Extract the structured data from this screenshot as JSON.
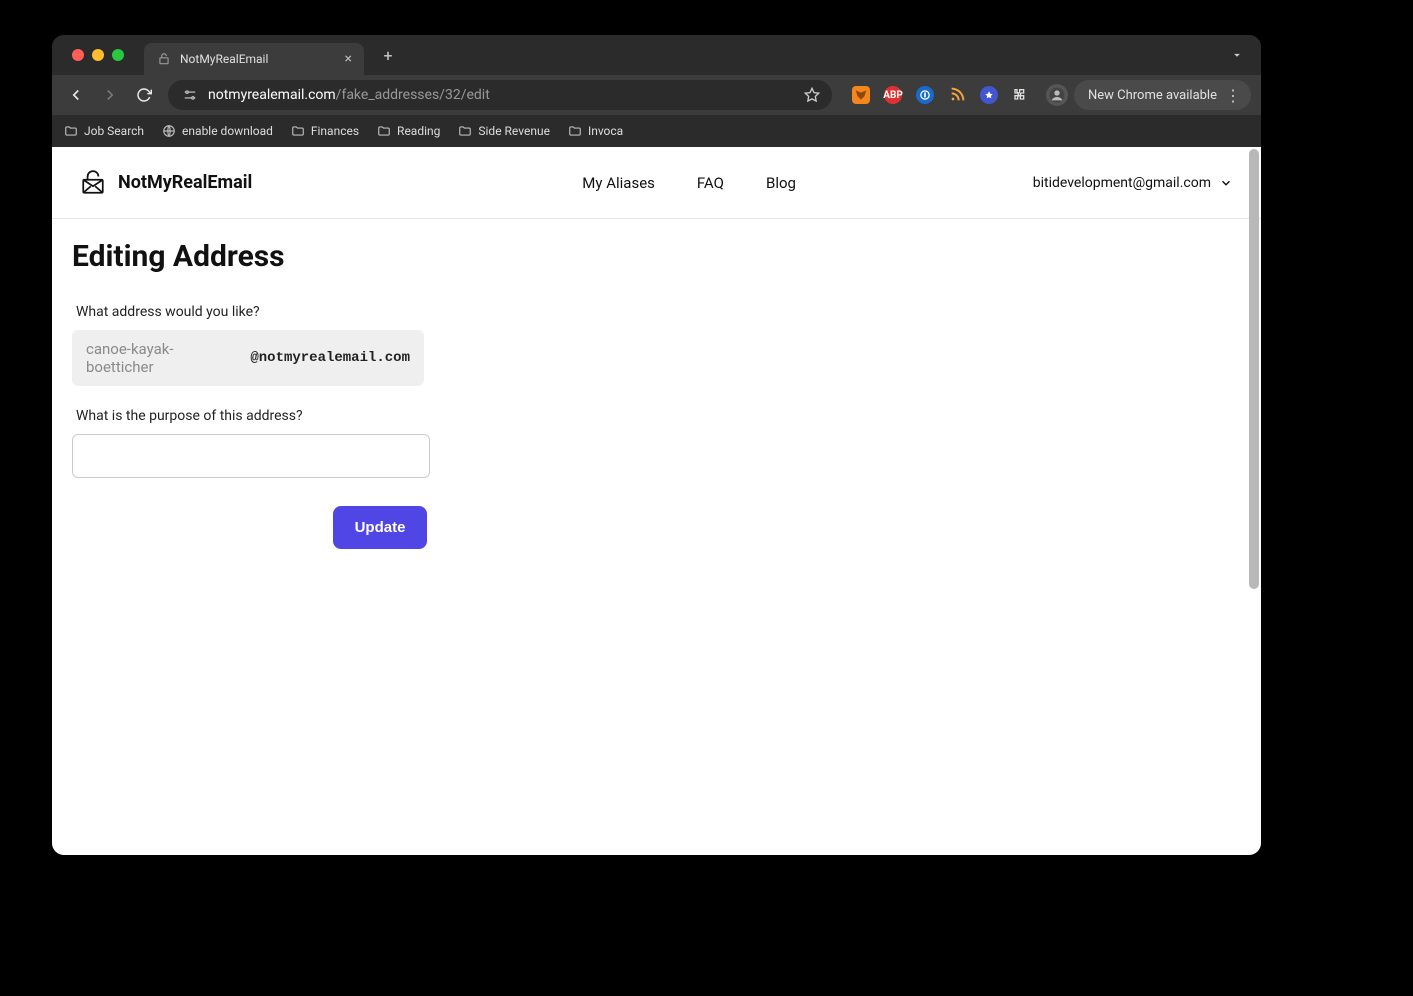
{
  "browser": {
    "tab": {
      "title": "NotMyRealEmail"
    },
    "url": {
      "domain": "notmyrealemail.com",
      "path": "/fake_addresses/32/edit"
    },
    "update_label": "New Chrome available",
    "bookmarks": [
      {
        "label": "Job Search",
        "icon": "folder"
      },
      {
        "label": "enable download",
        "icon": "globe"
      },
      {
        "label": "Finances",
        "icon": "folder"
      },
      {
        "label": "Reading",
        "icon": "folder"
      },
      {
        "label": "Side Revenue",
        "icon": "folder"
      },
      {
        "label": "Invoca",
        "icon": "folder"
      }
    ]
  },
  "app": {
    "brand": "NotMyRealEmail",
    "nav": [
      "My Aliases",
      "FAQ",
      "Blog"
    ],
    "account_email": "bitidevelopment@gmail.com"
  },
  "page": {
    "title": "Editing Address",
    "address_label": "What address would you like?",
    "alias_value": "canoe-kayak-boetticher",
    "alias_domain": "@notmyrealemail.com",
    "purpose_label": "What is the purpose of this address?",
    "purpose_value": "",
    "submit_label": "Update"
  },
  "colors": {
    "accent": "#4f46e5"
  }
}
